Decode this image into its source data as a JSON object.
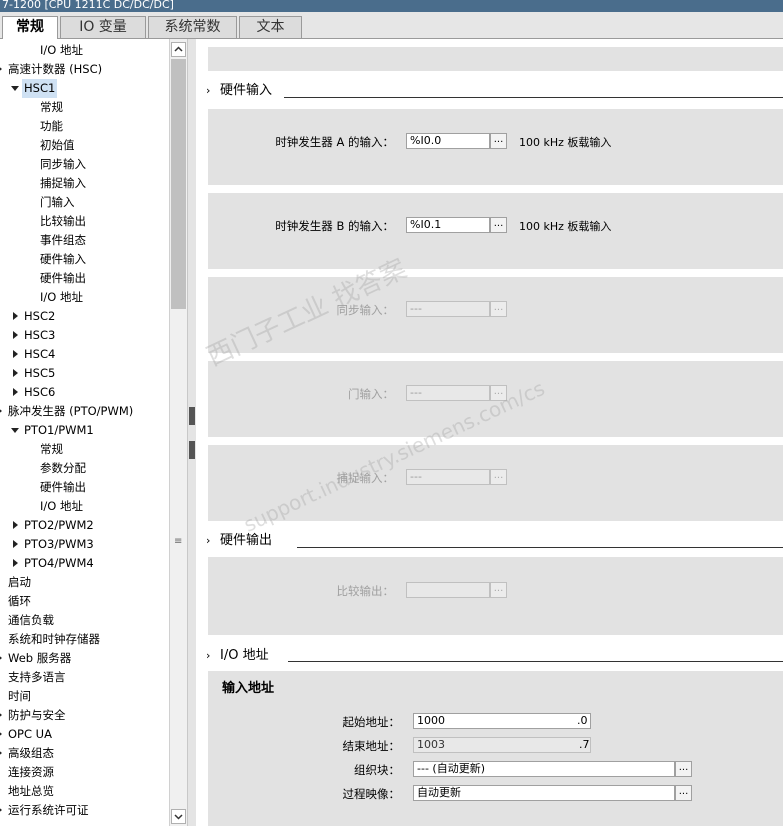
{
  "window": {
    "title": "7-1200 [CPU 1211C DC/DC/DC]"
  },
  "tabs": [
    {
      "label": "常规",
      "active": true
    },
    {
      "label": "IO 变量",
      "active": false
    },
    {
      "label": "系统常数",
      "active": false
    },
    {
      "label": "文本",
      "active": false
    }
  ],
  "tree": [
    {
      "label": "I/O 地址",
      "level": 2,
      "arrow": ""
    },
    {
      "label": "高速计数器 (HSC)",
      "level": 0,
      "arrow": "partial"
    },
    {
      "label": "HSC1",
      "level": 1,
      "arrow": "expanded",
      "selected": true
    },
    {
      "label": "常规",
      "level": 2,
      "arrow": ""
    },
    {
      "label": "功能",
      "level": 2,
      "arrow": ""
    },
    {
      "label": "初始值",
      "level": 2,
      "arrow": ""
    },
    {
      "label": "同步输入",
      "level": 2,
      "arrow": ""
    },
    {
      "label": "捕捉输入",
      "level": 2,
      "arrow": ""
    },
    {
      "label": "门输入",
      "level": 2,
      "arrow": ""
    },
    {
      "label": "比较输出",
      "level": 2,
      "arrow": ""
    },
    {
      "label": "事件组态",
      "level": 2,
      "arrow": ""
    },
    {
      "label": "硬件输入",
      "level": 2,
      "arrow": ""
    },
    {
      "label": "硬件输出",
      "level": 2,
      "arrow": ""
    },
    {
      "label": "I/O 地址",
      "level": 2,
      "arrow": ""
    },
    {
      "label": "HSC2",
      "level": 1,
      "arrow": "collapsed"
    },
    {
      "label": "HSC3",
      "level": 1,
      "arrow": "collapsed"
    },
    {
      "label": "HSC4",
      "level": 1,
      "arrow": "collapsed"
    },
    {
      "label": "HSC5",
      "level": 1,
      "arrow": "collapsed"
    },
    {
      "label": "HSC6",
      "level": 1,
      "arrow": "collapsed"
    },
    {
      "label": "脉冲发生器 (PTO/PWM)",
      "level": 0,
      "arrow": "partial"
    },
    {
      "label": "PTO1/PWM1",
      "level": 1,
      "arrow": "expanded"
    },
    {
      "label": "常规",
      "level": 2,
      "arrow": ""
    },
    {
      "label": "参数分配",
      "level": 2,
      "arrow": ""
    },
    {
      "label": "硬件输出",
      "level": 2,
      "arrow": ""
    },
    {
      "label": "I/O 地址",
      "level": 2,
      "arrow": ""
    },
    {
      "label": "PTO2/PWM2",
      "level": 1,
      "arrow": "collapsed"
    },
    {
      "label": "PTO3/PWM3",
      "level": 1,
      "arrow": "collapsed"
    },
    {
      "label": "PTO4/PWM4",
      "level": 1,
      "arrow": "collapsed"
    },
    {
      "label": "启动",
      "level": 0,
      "arrow": ""
    },
    {
      "label": "循环",
      "level": 0,
      "arrow": ""
    },
    {
      "label": "通信负载",
      "level": 0,
      "arrow": ""
    },
    {
      "label": "系统和时钟存储器",
      "level": 0,
      "arrow": ""
    },
    {
      "label": "Web 服务器",
      "level": 0,
      "arrow": "partial"
    },
    {
      "label": "支持多语言",
      "level": 0,
      "arrow": ""
    },
    {
      "label": "时间",
      "level": 0,
      "arrow": ""
    },
    {
      "label": "防护与安全",
      "level": 0,
      "arrow": "partial"
    },
    {
      "label": "OPC UA",
      "level": 0,
      "arrow": "partial"
    },
    {
      "label": "高级组态",
      "level": 0,
      "arrow": "partial"
    },
    {
      "label": "连接资源",
      "level": 0,
      "arrow": ""
    },
    {
      "label": "地址总览",
      "level": 0,
      "arrow": ""
    },
    {
      "label": "运行系统许可证",
      "level": 0,
      "arrow": "partial"
    }
  ],
  "sections": {
    "hw_input": {
      "title": "硬件输入",
      "clock_a": {
        "label": "时钟发生器 A 的输入：",
        "value": "%I0.0",
        "note": "100 kHz 板载输入"
      },
      "clock_b": {
        "label": "时钟发生器 B 的输入：",
        "value": "%I0.1",
        "note": "100 kHz 板载输入"
      },
      "sync": {
        "label": "同步输入：",
        "value": "---"
      },
      "gate": {
        "label": "门输入：",
        "value": "---"
      },
      "capture": {
        "label": "捕捉输入：",
        "value": "---"
      }
    },
    "hw_output": {
      "title": "硬件输出",
      "compare": {
        "label": "比较输出：",
        "value": ""
      }
    },
    "io_address": {
      "title": "I/O 地址",
      "subtitle": "输入地址",
      "start": {
        "label": "起始地址：",
        "value": "1000",
        "suffix": ".0"
      },
      "end": {
        "label": "结束地址：",
        "value": "1003",
        "suffix": ".7"
      },
      "ob": {
        "label": "组织块：",
        "value": "--- (自动更新)"
      },
      "process_image": {
        "label": "过程映像：",
        "value": "自动更新"
      }
    }
  },
  "watermark": {
    "line1": "西门子工业  找答案",
    "line2": "support.industry.siemens.com/cs"
  },
  "dots_label": "...",
  "colors": {
    "panel": "#e2e2e2",
    "selection": "#cfe1f3",
    "titlebar": "#4a6d8c"
  }
}
